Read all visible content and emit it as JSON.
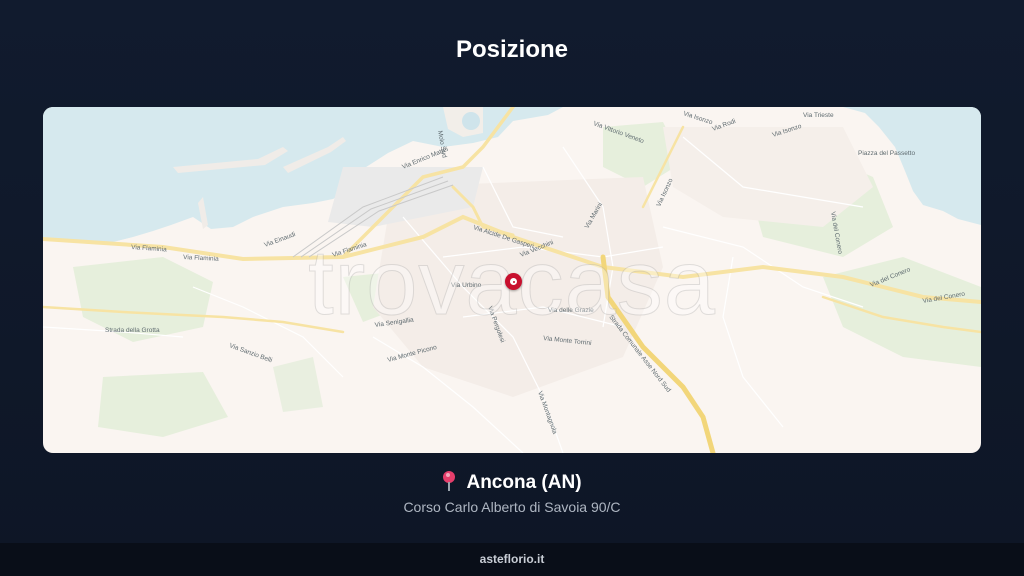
{
  "header": {
    "title": "Posizione"
  },
  "map": {
    "watermark": "trovacasa",
    "marker_icon": "map-marker-icon",
    "labels": {
      "via_flaminia_1": "Via Flaminia",
      "via_flaminia_2": "Via Flaminia",
      "via_enrico_mattei": "Via Enrico Mattei",
      "via_einaudi": "Via Einaudi",
      "via_de_gasperi": "Via Alcide De Gasperi",
      "via_vecchini": "Via Vecchini",
      "via_marini": "Via Marini",
      "via_isonzo_1": "Via Isonzo",
      "via_isonzo_2": "Via Isonzo",
      "via_isonzo_3": "Via Isonzo",
      "via_trieste": "Via Trieste",
      "via_rodi": "Via Rodi",
      "via_vittorio_veneto": "Via Vittorio Veneto",
      "via_del_conero_1": "Via del Conero",
      "via_del_conero_2": "Via del Conero",
      "via_del_conero_3": "Via del Conero",
      "via_urbino": "Via Urbino",
      "via_pergolesi": "Via Pergolesi",
      "via_grazie": "Via delle Grazie",
      "via_monte_torrini": "Via Monte Torrini",
      "via_monte_picono": "Via Monte Picono",
      "via_montagnola": "Via Montagnola",
      "via_senigallia": "Via Senigallia",
      "strada_grotta": "Strada della Grotta",
      "via_sanzio": "Via Sanzio Belli",
      "strada_svincolo": "Strada Comunale Asse Nord Sud",
      "piazza_passetto": "Piazza del Passetto",
      "molo_sud": "Molo Sud"
    }
  },
  "location": {
    "pin_icon": "pushpin-icon",
    "city": "Ancona (AN)",
    "address": "Corso Carlo Alberto di Savoia 90/C"
  },
  "footer": {
    "brand": "asteflorio.it"
  }
}
